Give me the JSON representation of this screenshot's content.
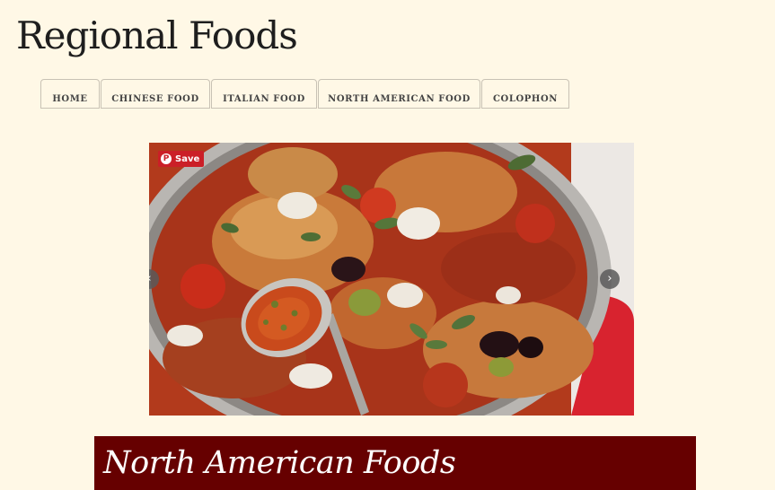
{
  "site": {
    "title": "Regional Foods"
  },
  "nav": {
    "tabs": [
      {
        "label": "HOME"
      },
      {
        "label": "CHINESE FOOD"
      },
      {
        "label": "ITALIAN FOOD"
      },
      {
        "label": "NORTH AMERICAN FOOD"
      },
      {
        "label": "COLOPHON"
      }
    ]
  },
  "slider": {
    "image_subject": "Chicken cacciatore in a steel pan with tomatoes, olives, capers, herbs and grated cheese",
    "pin_save_label": "Save",
    "prev_icon": "chevron-left-icon",
    "next_icon": "chevron-right-icon"
  },
  "section": {
    "title": "North American Foods"
  },
  "colors": {
    "page_background": "#fff8e6",
    "banner_background": "#660000",
    "pinterest_red": "#cb1f27"
  }
}
